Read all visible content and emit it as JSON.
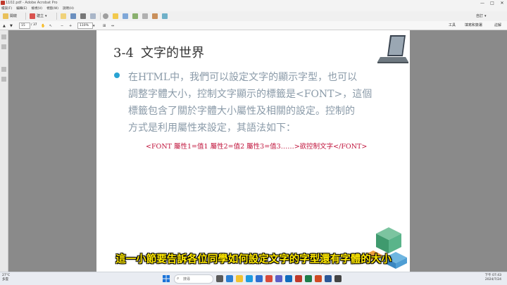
{
  "window": {
    "title": "1102.pdf - Adobe Acrobat Pro",
    "controls": [
      "—",
      "□",
      "✕"
    ]
  },
  "menu": [
    "檔案(F)",
    "編輯(E)",
    "檢視(V)",
    "視窗(W)",
    "說明(H)"
  ],
  "toolbar": {
    "open_label": "開啟",
    "create_label": "建立",
    "customize_label": "自訂"
  },
  "nav": {
    "page_current": "15",
    "page_total": "/ 37",
    "zoom": "110%",
    "tools_tab": "工具",
    "sign_tab": "填寫和簽署",
    "comment_tab": "註解"
  },
  "slide": {
    "title_num": "3-4",
    "title_text": "文字的世界",
    "body_lines": [
      "在HTML中，我們可以設定文字的顯示字型，也可以",
      "調整字體大小，控制文字顯示的標籤是<FONT>，這個",
      "標籤包含了關於字體大小屬性及相關的設定。控制的",
      "方式是利用屬性來設定，其語法如下："
    ],
    "syntax": "<FONT 屬性1=值1 屬性2=值2 屬性3=值3……>欲控制文字</FONT>"
  },
  "subtitle": "這一小節要告訴各位同學如何設定文字的字型還有字體的大小",
  "taskbar": {
    "weather_temp": "27°C",
    "weather_desc": "多雲",
    "search_placeholder": "搜尋",
    "time": "下午 07:43",
    "date": "2024/7/24"
  },
  "colors": {
    "accent_blue": "#29a3d3",
    "syntax_red": "#c0143c",
    "subtitle_yellow": "#ffe800"
  }
}
